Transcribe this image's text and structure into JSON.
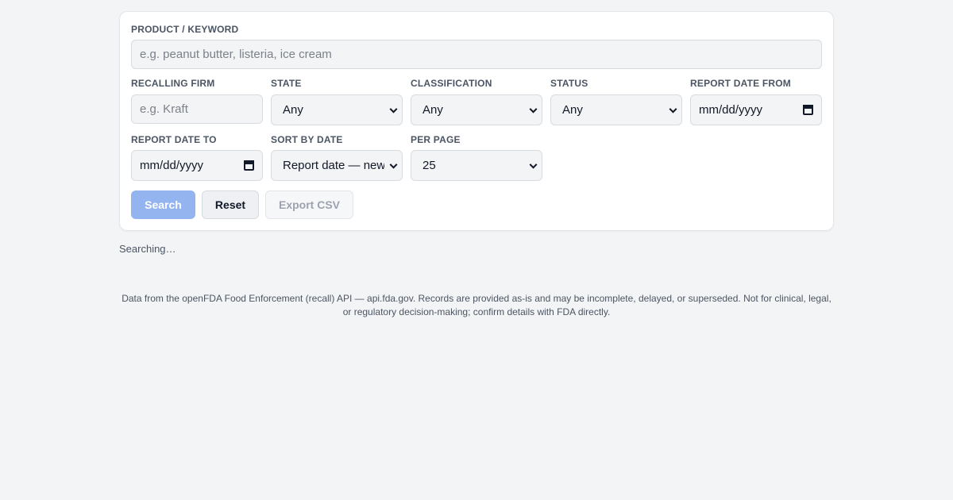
{
  "form": {
    "keyword": {
      "label": "PRODUCT / KEYWORD",
      "placeholder": "e.g. peanut butter, listeria, ice cream"
    },
    "firm": {
      "label": "RECALLING FIRM",
      "placeholder": "e.g. Kraft"
    },
    "state": {
      "label": "STATE",
      "value": "Any"
    },
    "classification": {
      "label": "CLASSIFICATION",
      "value": "Any"
    },
    "status": {
      "label": "STATUS",
      "value": "Any"
    },
    "date_from": {
      "label": "REPORT DATE FROM",
      "value": "mm/dd/yyyy"
    },
    "date_to": {
      "label": "REPORT DATE TO",
      "value": "mm/dd/yyyy"
    },
    "sort": {
      "label": "SORT BY DATE",
      "value": "Report date — newest first"
    },
    "per_page": {
      "label": "PER PAGE",
      "value": "25"
    }
  },
  "buttons": {
    "search": "Search",
    "reset": "Reset",
    "export": "Export CSV"
  },
  "status_text": "Searching…",
  "footer": "Data from the openFDA Food Enforcement (recall) API — api.fda.gov. Records are provided as-is and may be incomplete, delayed, or superseded. Not for clinical, legal, or regulatory decision-making; confirm details with FDA directly.",
  "colors": {
    "accent_disabled": "#93b4ef",
    "page_bg": "#f3f4f6",
    "card_bg": "#ffffff"
  },
  "icons": {
    "select": "chevron-down-icon",
    "date": "calendar-icon"
  }
}
